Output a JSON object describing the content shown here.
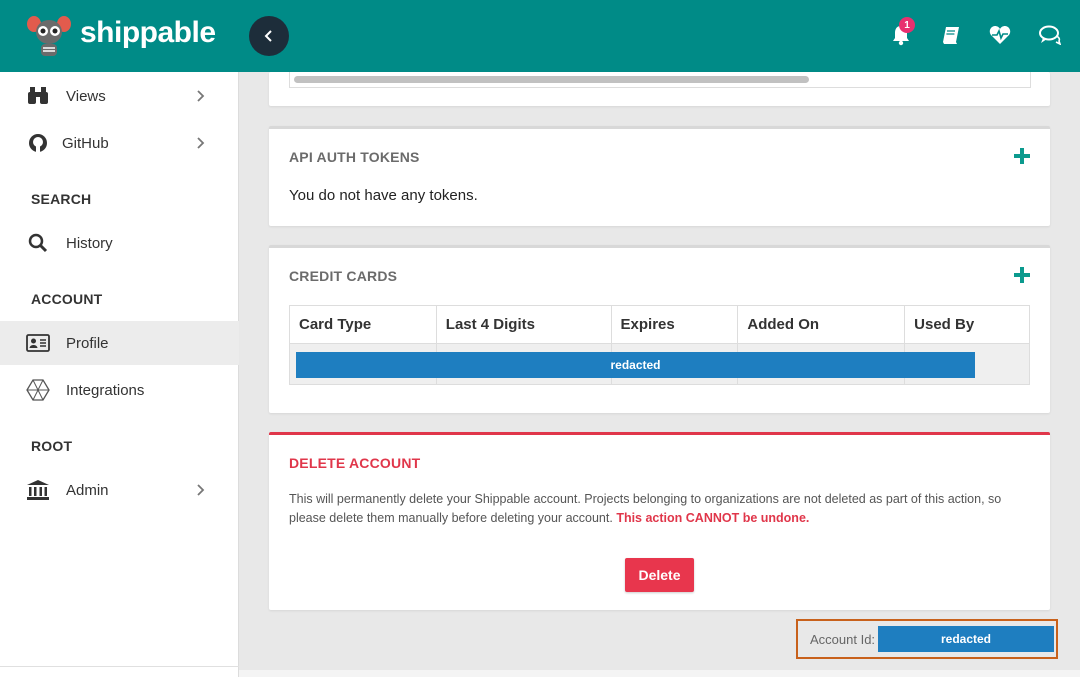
{
  "header": {
    "brand": "shippable",
    "notifications_count": "1",
    "colors": {
      "bar": "#008b87",
      "badge": "#e8306f"
    },
    "icons": [
      "bell-icon",
      "book-icon",
      "heartbeat-icon",
      "chat-icon"
    ]
  },
  "sidebar": {
    "items": [
      {
        "label": "Views",
        "icon": "binoculars-icon"
      },
      {
        "label": "GitHub",
        "icon": "github-icon"
      }
    ],
    "search_heading": "SEARCH",
    "history_label": "History",
    "account_heading": "ACCOUNT",
    "profile_label": "Profile",
    "integrations_label": "Integrations",
    "root_heading": "ROOT",
    "admin_label": "Admin"
  },
  "main": {
    "tokens": {
      "title": "API AUTH TOKENS",
      "empty_text": "You do not have any tokens."
    },
    "credit_cards": {
      "title": "CREDIT CARDS",
      "columns": [
        "Card Type",
        "Last 4 Digits",
        "Expires",
        "Added On",
        "Used By"
      ],
      "redacted_text": "redacted"
    },
    "delete_account": {
      "title": "DELETE ACCOUNT",
      "description": "This will permanently delete your Shippable account. Projects belonging to organizations are not deleted as part of this action, so please delete them manually before deleting your account.",
      "warning": "This action CANNOT be undone.",
      "button_label": "Delete",
      "accent_color": "#e0364a"
    },
    "account_id": {
      "label": "Account Id:",
      "value": "redacted"
    }
  }
}
